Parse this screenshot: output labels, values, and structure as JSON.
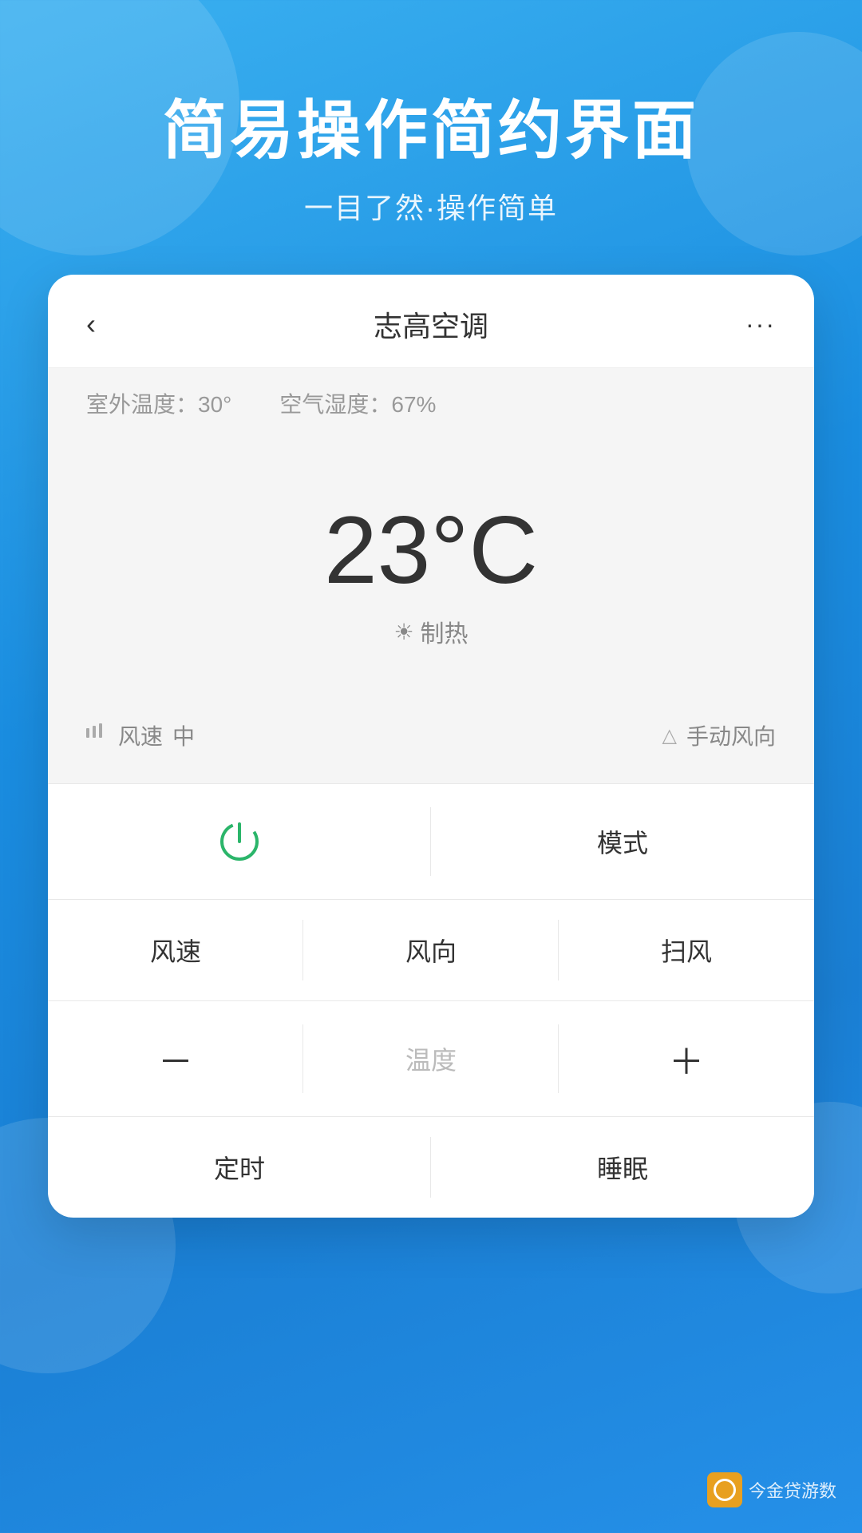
{
  "background": {
    "gradient_start": "#3ab0f0",
    "gradient_end": "#1a7fd4"
  },
  "hero": {
    "title": "简易操作简约界面",
    "subtitle": "一目了然·操作简单"
  },
  "card": {
    "header": {
      "back_label": "‹",
      "title": "志高空调",
      "more_label": "···"
    },
    "status": {
      "outdoor_temp_label": "室外温度：",
      "outdoor_temp_value": "30°",
      "humidity_label": "空气湿度：",
      "humidity_value": "67%"
    },
    "temperature": {
      "value": "23°C",
      "mode_icon": "☀",
      "mode_text": "制热"
    },
    "wind_bar": {
      "speed_icon": "▐▐",
      "speed_label": "风速",
      "speed_value": "中",
      "direction_icon": "△",
      "direction_label": "手动风向"
    },
    "controls": {
      "power_label": "",
      "mode_label": "模式",
      "wind_speed_label": "风速",
      "wind_dir_label": "风向",
      "wind_sweep_label": "扫风",
      "temp_minus_label": "－",
      "temp_center_label": "温度",
      "temp_plus_label": "＋",
      "timer_label": "定时",
      "sleep_label": "睡眠"
    }
  },
  "watermark": {
    "text": "今金贷游数"
  }
}
